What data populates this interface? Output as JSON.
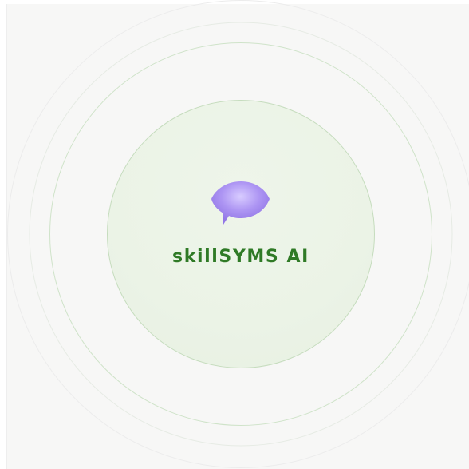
{
  "brand": {
    "name": "skillSYMS AI",
    "icon": "speech-bubble-icon",
    "icon_color": "#a58cf0",
    "text_color": "#2f7a26"
  },
  "colors": {
    "panel_background": "#f7f7f6",
    "inner_circle_fill": "#ebf3e6",
    "ring_green": "#cfe3c9",
    "ring_gray": "#ececec"
  }
}
